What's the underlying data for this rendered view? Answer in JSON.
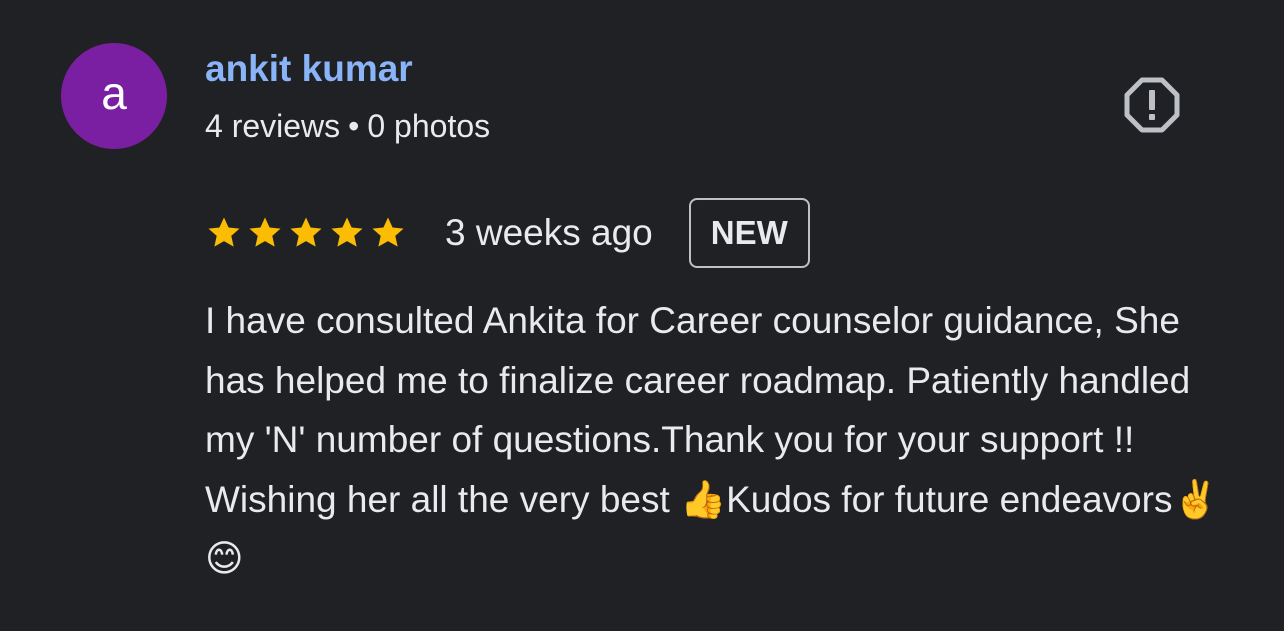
{
  "review": {
    "author": {
      "avatar_letter": "a",
      "avatar_color": "#7b1fa2",
      "name": "ankit kumar",
      "reviews_count": "4 reviews",
      "separator": "•",
      "photos_count": "0 photos"
    },
    "report_icon": "report-flag-icon",
    "rating": 5,
    "rating_max": 5,
    "star_color": "#fbbc04",
    "time": "3 weeks ago",
    "badge": "NEW",
    "text": "I have consulted Ankita for Career counselor guidance, She has helped me to finalize career roadmap. Patiently handled my 'N' number of questions.Thank you for your support !! Wishing her all the very best 👍Kudos for future endeavors✌️ 😊"
  }
}
